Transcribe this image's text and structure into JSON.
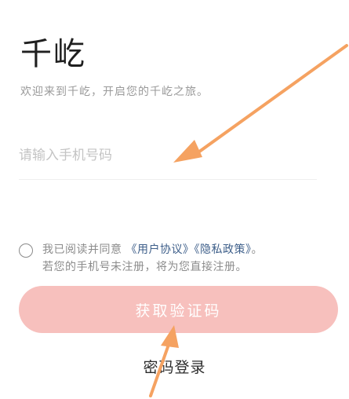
{
  "app": {
    "title": "千屹"
  },
  "welcome": {
    "text": "欢迎来到千屹，开启您的千屹之旅。"
  },
  "login": {
    "phone_placeholder": "请输入手机号码",
    "agree_prefix": "我已阅读并同意",
    "user_agreement": "《用户协议》",
    "privacy_policy": "《隐私政策》",
    "agree_suffix": "。",
    "register_hint": "若您的手机号未注册，将为您直接注册。",
    "get_code_label": "获取验证码",
    "password_login_label": "密码登录"
  },
  "colors": {
    "button_bg": "#f7c0bd",
    "link": "#3e5f8a",
    "annotation_arrow": "#f5a261"
  }
}
